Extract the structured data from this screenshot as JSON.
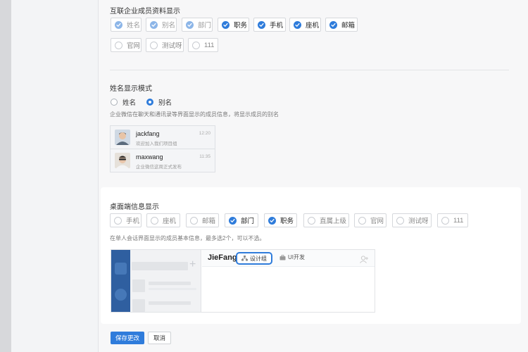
{
  "contact_fields": {
    "title": "互联企业成员资料显示",
    "items": [
      {
        "label": "姓名",
        "state": "disabled"
      },
      {
        "label": "别名",
        "state": "disabled"
      },
      {
        "label": "部门",
        "state": "disabled"
      },
      {
        "label": "职务",
        "state": "checked"
      },
      {
        "label": "手机",
        "state": "checked"
      },
      {
        "label": "座机",
        "state": "checked"
      },
      {
        "label": "邮箱",
        "state": "checked"
      },
      {
        "label": "官网",
        "state": "unchecked"
      },
      {
        "label": "测试呀",
        "state": "unchecked"
      },
      {
        "label": "111",
        "state": "unchecked"
      }
    ]
  },
  "name_mode": {
    "title": "姓名显示模式",
    "options": [
      {
        "label": "姓名",
        "selected": false
      },
      {
        "label": "别名",
        "selected": true
      }
    ],
    "hint": "企业微信在聊天和通讯录等界面显示的成员信息，将显示成员的别名",
    "preview": [
      {
        "name": "jackfang",
        "message": "欢迎加入我们项目组",
        "time": "12:20"
      },
      {
        "name": "maxwang",
        "message": "企业微信这周正式发布",
        "time": "11:35"
      }
    ]
  },
  "desktop_info": {
    "title": "桌面端信息显示",
    "items": [
      {
        "label": "手机",
        "state": "unchecked"
      },
      {
        "label": "座机",
        "state": "unchecked"
      },
      {
        "label": "邮箱",
        "state": "unchecked"
      },
      {
        "label": "部门",
        "state": "checked"
      },
      {
        "label": "职务",
        "state": "checked"
      },
      {
        "label": "直属上级",
        "state": "unchecked"
      },
      {
        "label": "官网",
        "state": "unchecked"
      },
      {
        "label": "测试呀",
        "state": "unchecked"
      },
      {
        "label": "111",
        "state": "unchecked"
      }
    ],
    "hint": "在单人会话界面显示的成员基本信息，最多选2个，可以不选。",
    "preview": {
      "name": "JieFang",
      "department": "设计组",
      "position": "UI开发"
    }
  },
  "actions": {
    "save_label": "保存更改",
    "cancel_label": "取消"
  },
  "colors": {
    "accent": "#2f7cdb",
    "disabled_check": "#8db6e8",
    "card": "#ffffff",
    "page_bg": "#f7f7f8"
  }
}
